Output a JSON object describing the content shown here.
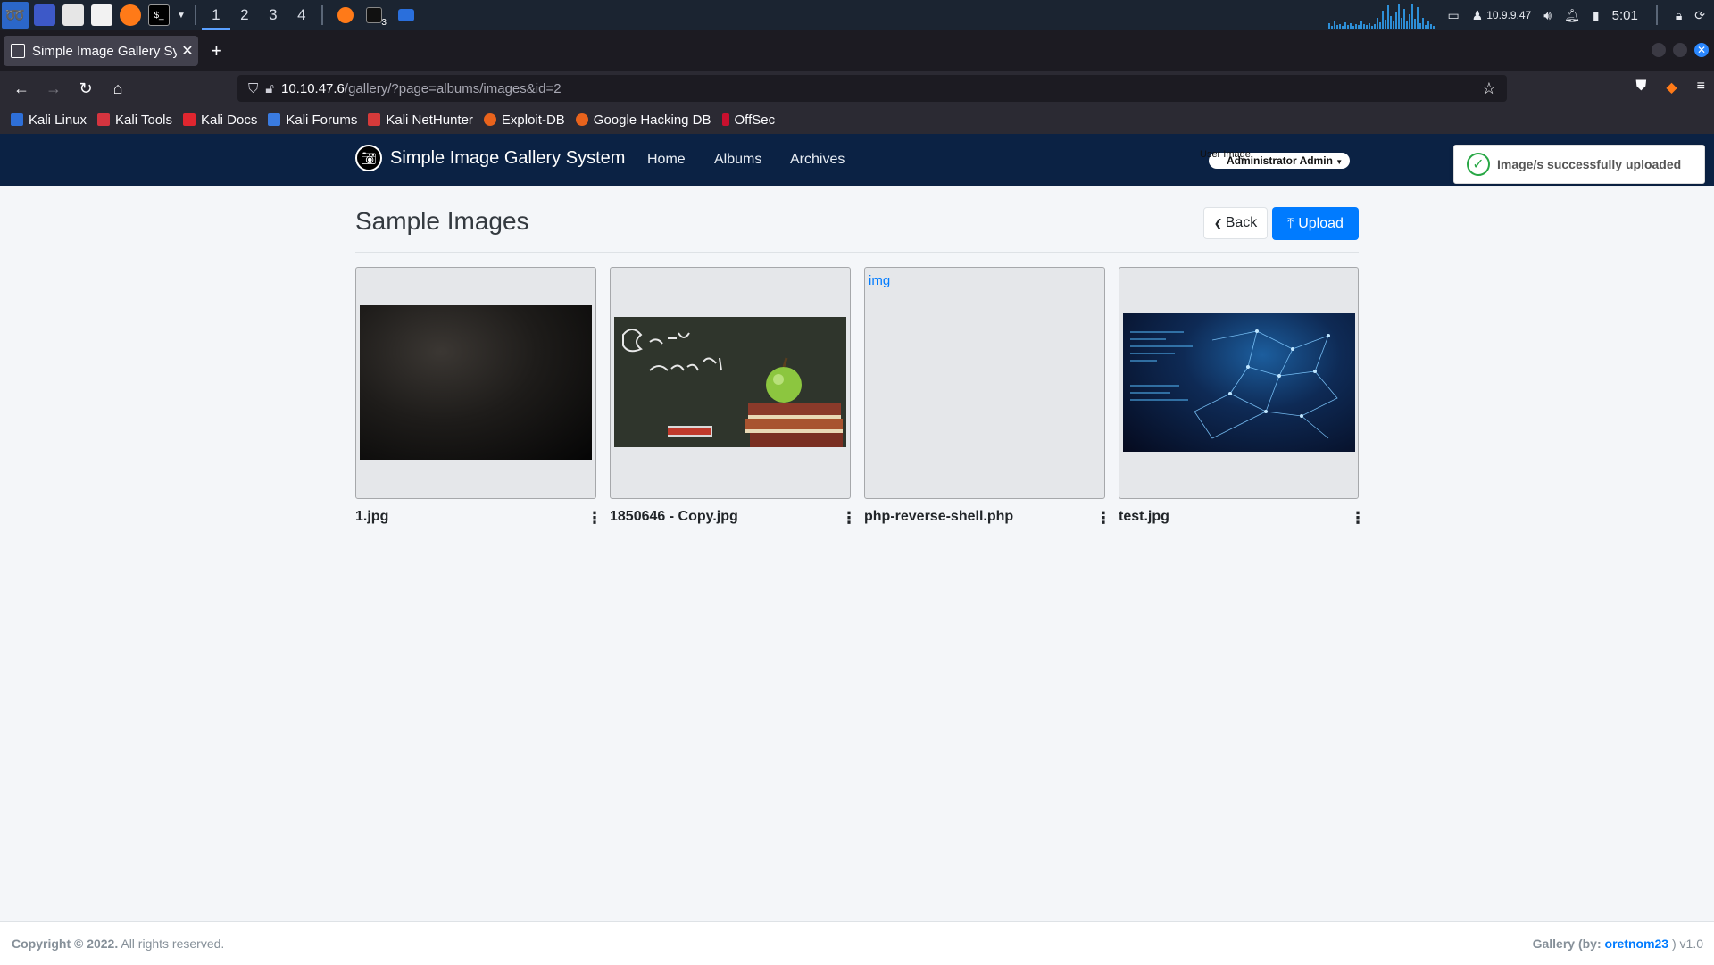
{
  "taskbar": {
    "workspaces": [
      "1",
      "2",
      "3",
      "4"
    ],
    "active_workspace": "1",
    "ip": "10.9.9.47",
    "clock": "5:01",
    "badge": "3"
  },
  "browser": {
    "tab_title": "Simple Image Gallery Syst",
    "url_host": "10.10.47.6",
    "url_path": "/gallery/?page=albums/images&id=2",
    "bookmarks": [
      "Kali Linux",
      "Kali Tools",
      "Kali Docs",
      "Kali Forums",
      "Kali NetHunter",
      "Exploit-DB",
      "Google Hacking DB",
      "OffSec"
    ]
  },
  "site": {
    "brand": "Simple Image Gallery System",
    "nav": {
      "home": "Home",
      "albums": "Albums",
      "archives": "Archives"
    },
    "user_image_alt": "User Image",
    "user_name": "Administrator Admin",
    "toast": "Image/s successfully uploaded"
  },
  "page": {
    "title": "Sample Images",
    "back_label": "Back",
    "upload_label": "Upload",
    "images": [
      {
        "name": "1.jpg"
      },
      {
        "name": "1850646 - Copy.jpg"
      },
      {
        "name": "php-reverse-shell.php",
        "broken_alt": "img"
      },
      {
        "name": "test.jpg"
      }
    ]
  },
  "footer": {
    "copyright": "Copyright © 2022.",
    "rights": " All rights reserved.",
    "gallery_prefix": "Gallery (by: ",
    "author": "oretnom23",
    "version": " ) v1.0"
  },
  "colors": {
    "site_nav": "#0b2244",
    "primary": "#007bff",
    "success": "#28a745"
  }
}
